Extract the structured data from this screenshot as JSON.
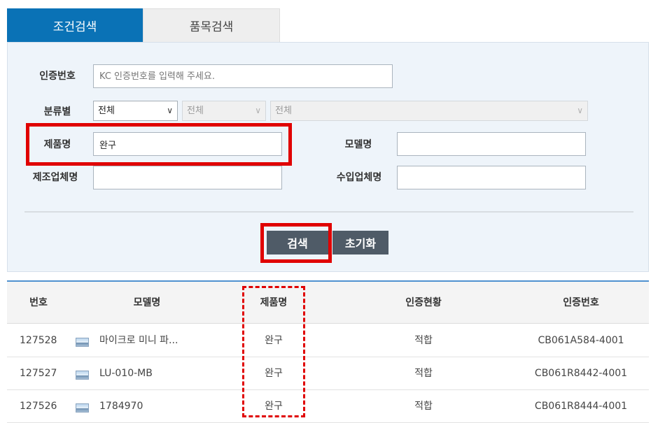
{
  "tabs": [
    {
      "label": "조건검색",
      "active": true
    },
    {
      "label": "품목검색",
      "active": false
    }
  ],
  "form": {
    "cert_no": {
      "label": "인증번호",
      "placeholder": "KC 인증번호를 입력해 주세요."
    },
    "category": {
      "label": "분류별",
      "select1": "전체",
      "select2": "전체",
      "select3": "전체"
    },
    "product_name": {
      "label": "제품명",
      "value": "완구"
    },
    "model_name": {
      "label": "모델명",
      "value": ""
    },
    "manufacturer": {
      "label": "제조업체명",
      "value": ""
    },
    "importer": {
      "label": "수입업체명",
      "value": ""
    }
  },
  "buttons": {
    "search": "검색",
    "reset": "초기화"
  },
  "table": {
    "headers": [
      "번호",
      "모델명",
      "제품명",
      "인증현황",
      "인증번호"
    ],
    "rows": [
      {
        "no": "127528",
        "model": "마이크로 미니 파...",
        "product": "완구",
        "status": "적합",
        "cert": "CB061A584-4001"
      },
      {
        "no": "127527",
        "model": "LU-010-MB",
        "product": "완구",
        "status": "적합",
        "cert": "CB061R8442-4001"
      },
      {
        "no": "127526",
        "model": "1784970",
        "product": "완구",
        "status": "적합",
        "cert": "CB061R8444-4001"
      }
    ]
  },
  "colors": {
    "tab_active": "#0a72b6",
    "button": "#4f5b67",
    "highlight": "#e00000",
    "panel_bg": "#eef4fa"
  }
}
